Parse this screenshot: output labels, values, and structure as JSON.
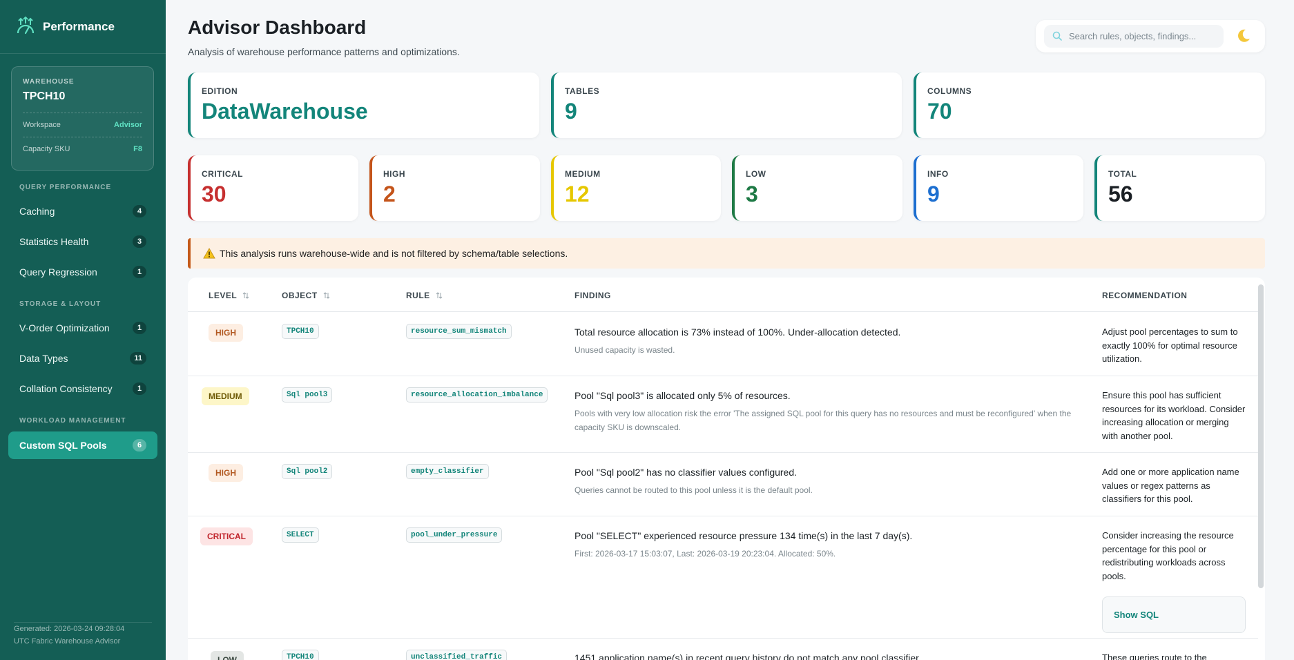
{
  "sidebar": {
    "brand": "Performance",
    "warehouse": {
      "label": "WAREHOUSE",
      "name": "TPCH10",
      "rows": [
        {
          "label": "Workspace",
          "value": "Advisor"
        },
        {
          "label": "Capacity SKU",
          "value": "F8"
        }
      ]
    },
    "sections": [
      {
        "title": "QUERY PERFORMANCE"
      },
      {
        "title": "STORAGE & LAYOUT"
      },
      {
        "title": "WORKLOAD MANAGEMENT"
      }
    ],
    "items": [
      {
        "label": "Caching",
        "count": "4"
      },
      {
        "label": "Statistics Health",
        "count": "3"
      },
      {
        "label": "Query Regression",
        "count": "1"
      },
      {
        "label": "V-Order Optimization",
        "count": "1"
      },
      {
        "label": "Data Types",
        "count": "11"
      },
      {
        "label": "Collation Consistency",
        "count": "1"
      },
      {
        "label": "Custom SQL Pools",
        "count": "6"
      }
    ],
    "footer": {
      "line1": "Generated: 2026-03-24 09:28:04",
      "line2": "UTC Fabric Warehouse Advisor"
    }
  },
  "header": {
    "title": "Advisor Dashboard",
    "subtitle": "Analysis of warehouse performance patterns and optimizations.",
    "search_placeholder": "Search rules, objects, findings..."
  },
  "summary": [
    {
      "label": "EDITION",
      "value": "DataWarehouse",
      "color": "#13857a"
    },
    {
      "label": "TABLES",
      "value": "9",
      "color": "#13857a"
    },
    {
      "label": "COLUMNS",
      "value": "70",
      "color": "#13857a"
    }
  ],
  "severity": [
    {
      "label": "CRITICAL",
      "value": "30",
      "color": "#c62f2f"
    },
    {
      "label": "HIGH",
      "value": "2",
      "color": "#c4541a"
    },
    {
      "label": "MEDIUM",
      "value": "12",
      "color": "#e6c700"
    },
    {
      "label": "LOW",
      "value": "3",
      "color": "#1e7a45"
    },
    {
      "label": "INFO",
      "value": "9",
      "color": "#1d6fd0"
    },
    {
      "label": "TOTAL",
      "value": "56",
      "color": "#1a1f24"
    }
  ],
  "notice": "This analysis runs warehouse-wide and is not filtered by schema/table selections.",
  "table": {
    "columns": [
      "LEVEL",
      "OBJECT",
      "RULE",
      "FINDING",
      "RECOMMENDATION"
    ],
    "show_sql_label": "Show SQL",
    "rows": [
      {
        "level": "HIGH",
        "object": "TPCH10",
        "rule": "resource_sum_mismatch",
        "finding": "Total resource allocation is 73% instead of 100%. Under-allocation detected.",
        "detail": "Unused capacity is wasted.",
        "recommendation": "Adjust pool percentages to sum to exactly 100% for optimal resource utilization."
      },
      {
        "level": "MEDIUM",
        "object": "Sql pool3",
        "rule": "resource_allocation_imbalance",
        "finding": "Pool \"Sql pool3\" is allocated only 5% of resources.",
        "detail": "Pools with very low allocation risk the error 'The assigned SQL pool for this query has no resources and must be reconfigured' when the capacity SKU is downscaled.",
        "recommendation": "Ensure this pool has sufficient resources for its workload. Consider increasing allocation or merging with another pool."
      },
      {
        "level": "HIGH",
        "object": "Sql pool2",
        "rule": "empty_classifier",
        "finding": "Pool \"Sql pool2\" has no classifier values configured.",
        "detail": "Queries cannot be routed to this pool unless it is the default pool.",
        "recommendation": "Add one or more application name values or regex patterns as classifiers for this pool."
      },
      {
        "level": "CRITICAL",
        "object": "SELECT",
        "rule": "pool_under_pressure",
        "finding": "Pool \"SELECT\" experienced resource pressure 134 time(s) in the last 7 day(s).",
        "detail": "First: 2026-03-17 15:03:07, Last: 2026-03-19 20:23:04. Allocated: 50%.",
        "recommendation": "Consider increasing the resource percentage for this pool or redistributing workloads across pools."
      },
      {
        "level": "LOW",
        "object": "TPCH10",
        "rule": "unclassified_traffic",
        "finding": "1451 application name(s) in recent query history do not match any pool classifier.",
        "detail": "",
        "recommendation": "These queries route to the"
      }
    ]
  }
}
